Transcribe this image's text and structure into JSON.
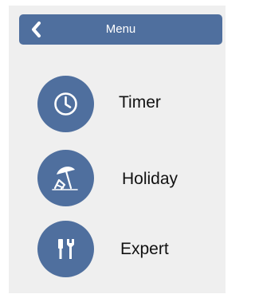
{
  "header": {
    "title": "Menu",
    "back_icon": "chevron-left-icon"
  },
  "menu": {
    "items": [
      {
        "label": "Timer",
        "icon": "clock-icon"
      },
      {
        "label": "Holiday",
        "icon": "beach-umbrella-icon"
      },
      {
        "label": "Expert",
        "icon": "tools-icon"
      }
    ]
  },
  "colors": {
    "accent": "#4f6f9e",
    "background": "#efefef",
    "text": "#111111",
    "header_text": "#ffffff"
  }
}
